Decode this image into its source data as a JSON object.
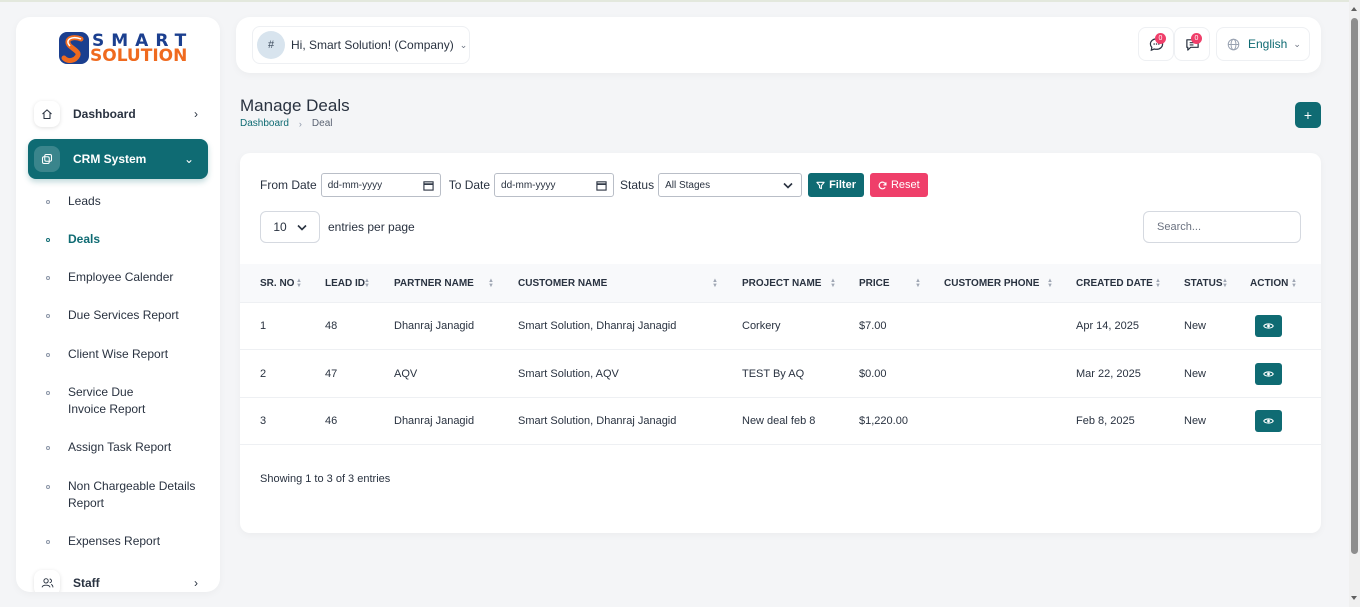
{
  "brand": {
    "logo_top": "SMART",
    "logo_bottom": "SOLUTION",
    "colors": {
      "primary": "#0f6b73",
      "accent": "#ef3f6a",
      "logo_blue": "#1b3f8f",
      "logo_orange": "#ef6a1f"
    }
  },
  "sidebar": {
    "dashboard": {
      "label": "Dashboard",
      "icon": "home-icon"
    },
    "crm": {
      "label": "CRM System",
      "icon": "crm-icon"
    },
    "sub_items": [
      {
        "label": "Leads"
      },
      {
        "label": "Deals"
      },
      {
        "label": "Employee Calender"
      },
      {
        "label": "Due Services Report"
      },
      {
        "label": "Client Wise Report"
      },
      {
        "label": "Service Due Invoice Report"
      },
      {
        "label": "Assign Task Report"
      },
      {
        "label": "Non Chargeable Details Report"
      },
      {
        "label": "Expenses Report"
      }
    ],
    "active_sub": "Deals",
    "staff": {
      "label": "Staff",
      "icon": "users-icon"
    }
  },
  "header": {
    "avatar_text": "#",
    "user_greeting": "Hi, Smart Solution! (Company)",
    "messages_badge": "0",
    "chat_badge": "0",
    "language": "English"
  },
  "page": {
    "title": "Manage Deals",
    "breadcrumb": [
      "Dashboard",
      "Deal"
    ]
  },
  "filters": {
    "from_label": "From Date",
    "from_placeholder": "dd-mm-yyyy",
    "to_label": "To Date",
    "to_placeholder": "dd-mm-yyyy",
    "status_label": "Status",
    "status_selected": "All Stages",
    "filter_button": "Filter",
    "reset_button": "Reset"
  },
  "entries": {
    "value": "10",
    "label": "entries per page",
    "search_placeholder": "Search..."
  },
  "table": {
    "columns": [
      "SR. NO",
      "LEAD ID",
      "PARTNER NAME",
      "CUSTOMER NAME",
      "PROJECT NAME",
      "PRICE",
      "CUSTOMER PHONE",
      "CREATED DATE",
      "STATUS",
      "ACTION"
    ],
    "rows": [
      {
        "sr": "1",
        "lead_id": "48",
        "partner": "Dhanraj Janagid",
        "customer": "Smart Solution, Dhanraj Janagid",
        "project": "Corkery",
        "price": "$7.00",
        "phone": "",
        "created": "Apr 14, 2025",
        "status": "New"
      },
      {
        "sr": "2",
        "lead_id": "47",
        "partner": "AQV",
        "customer": "Smart Solution, AQV",
        "project": "TEST By AQ",
        "price": "$0.00",
        "phone": "",
        "created": "Mar 22, 2025",
        "status": "New"
      },
      {
        "sr": "3",
        "lead_id": "46",
        "partner": "Dhanraj Janagid",
        "customer": "Smart Solution, Dhanraj Janagid",
        "project": "New deal feb 8",
        "price": "$1,220.00",
        "phone": "",
        "created": "Feb 8, 2025",
        "status": "New"
      }
    ],
    "showing": "Showing 1 to 3 of 3 entries"
  }
}
